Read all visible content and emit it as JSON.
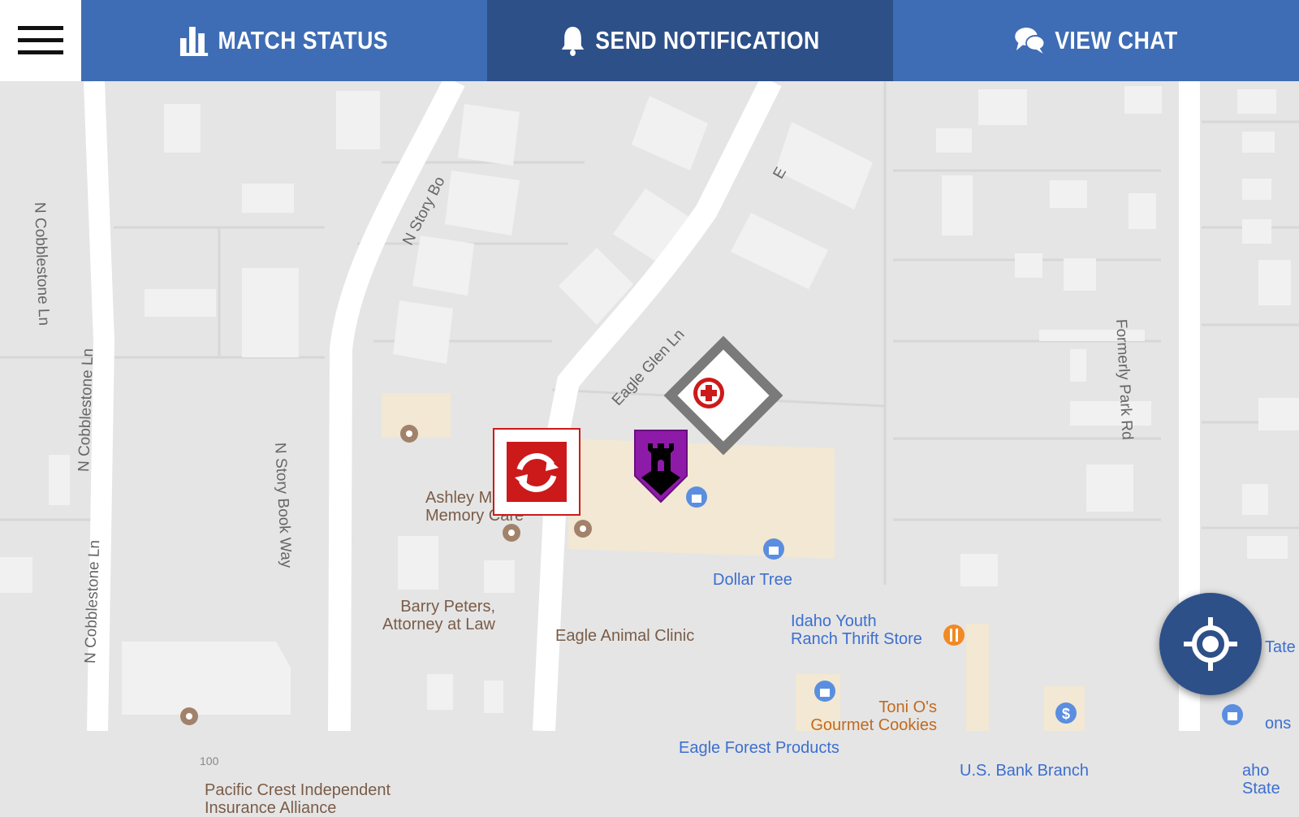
{
  "toolbar": {
    "menu_icon": "hamburger-menu-icon",
    "tabs": [
      {
        "label": "MATCH STATUS",
        "icon": "bar-chart-icon",
        "color": "#3f6db5"
      },
      {
        "label": "SEND NOTIFICATION",
        "icon": "bell-icon",
        "color": "#2d5089"
      },
      {
        "label": "VIEW CHAT",
        "icon": "chat-bubbles-icon",
        "color": "#3f6db5"
      }
    ]
  },
  "map": {
    "streets": [
      "N Cobblestone Ln",
      "N Cobblestone Ln",
      "N Cobblestone Ln",
      "N Story Book Way",
      "N Story Bo",
      "Eagle Glen Ln",
      "E",
      "Formerly Park Rd"
    ],
    "places": [
      {
        "name": "Ashley M",
        "name2": "Memory Care",
        "type": "poi-brown"
      },
      {
        "name": "Barry Peters,",
        "name2": "Attorney at Law",
        "type": "poi-brown"
      },
      {
        "name": "Eagle Animal Clinic",
        "type": "poi-brown"
      },
      {
        "name": "Dollar Tree",
        "type": "shop-blue"
      },
      {
        "name": "Idaho Youth",
        "name2": "Ranch Thrift Store",
        "type": "shop-blue"
      },
      {
        "name": "Toni O's",
        "name2": "Gourmet Cookies",
        "type": "food-orange"
      },
      {
        "name": "Eagle Forest Products",
        "type": "shop-blue"
      },
      {
        "name": "U.S. Bank Branch",
        "type": "bank-blue"
      },
      {
        "name": "Pacific Crest Independent",
        "name2": "Insurance Alliance",
        "type": "poi-brown"
      },
      {
        "name": "Tate",
        "type": "shop-blue"
      },
      {
        "name": "ons",
        "type": "shop-blue"
      },
      {
        "name": "aho State",
        "type": "shop-blue"
      }
    ],
    "address_number": "100",
    "markers": [
      "respawn-marker-icon",
      "castle-marker-icon",
      "medic-marker-icon"
    ]
  },
  "locate_button": {
    "icon": "my-location-icon"
  },
  "colors": {
    "accent": "#3f6db5",
    "accent_dark": "#2d5089",
    "marker_red": "#cc1a1a",
    "marker_purple": "#8e1aa8"
  }
}
